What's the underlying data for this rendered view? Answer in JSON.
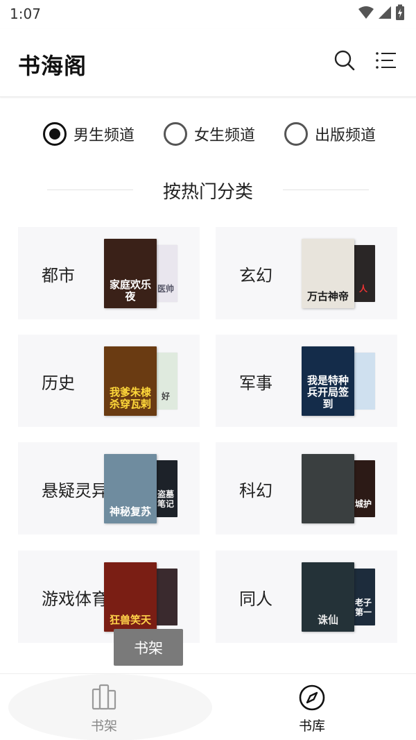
{
  "status_bar": {
    "time": "1:07",
    "icons": [
      "wifi-icon",
      "signal-icon",
      "battery-charging-icon"
    ]
  },
  "header": {
    "title": "书海阁",
    "icons": [
      "search-icon",
      "menu-list-icon"
    ]
  },
  "channels": [
    {
      "label": "男生频道",
      "selected": true
    },
    {
      "label": "女生频道",
      "selected": false
    },
    {
      "label": "出版频道",
      "selected": false
    }
  ],
  "section": {
    "title": "按热门分类"
  },
  "categories": [
    {
      "label": "都市",
      "front_cover_text": "家庭欢乐夜",
      "back_cover_text": "医帅",
      "front_color": "#3a2118",
      "front_text_color": "#ffffff",
      "back_color": "#e9e6ee",
      "back_text_color": "#556"
    },
    {
      "label": "玄幻",
      "front_cover_text": "万古神帝",
      "back_cover_text": "人",
      "front_color": "#e8e4dc",
      "front_text_color": "#1b1b1b",
      "back_color": "#2a2626",
      "back_text_color": "#e33"
    },
    {
      "label": "历史",
      "front_cover_text": "我爹朱棣杀穿瓦剌",
      "back_cover_text": "好",
      "front_color": "#6a3b12",
      "front_text_color": "#ffd83a",
      "back_color": "#dfeade",
      "back_text_color": "#444"
    },
    {
      "label": "军事",
      "front_cover_text": "我是特种兵开局签到",
      "back_cover_text": "",
      "front_color": "#142c4a",
      "front_text_color": "#ffffff",
      "back_color": "#cfe0ef",
      "back_text_color": "#333"
    },
    {
      "label": "悬疑灵异",
      "front_cover_text": "神秘复苏",
      "back_cover_text": "盗墓笔记",
      "front_color": "#6f8c9f",
      "front_text_color": "#ffffff",
      "back_color": "#1d2229",
      "back_text_color": "#f0f0f0"
    },
    {
      "label": "科幻",
      "front_cover_text": "",
      "back_cover_text": "城护",
      "front_color": "#3a3f40",
      "front_text_color": "#ffffff",
      "back_color": "#2c1a16",
      "back_text_color": "#ffffff"
    },
    {
      "label": "游戏体育",
      "front_cover_text": "狂兽笑天",
      "back_cover_text": "",
      "front_color": "#7a1e14",
      "front_text_color": "#ffd24a",
      "back_color": "#3a2a2e",
      "back_text_color": "#fff"
    },
    {
      "label": "同人",
      "front_cover_text": "诛仙",
      "back_cover_text": "老子第一",
      "front_color": "#243238",
      "front_text_color": "#e8e8e8",
      "back_color": "#1d2c3c",
      "back_text_color": "#ffffff"
    }
  ],
  "tooltip": {
    "text": "书架"
  },
  "bottom_nav": {
    "items": [
      {
        "label": "书架",
        "icon": "bookshelf-icon",
        "active": false
      },
      {
        "label": "书库",
        "icon": "compass-icon",
        "active": true
      }
    ]
  },
  "colors": {
    "card_bg": "#f7f7f9",
    "accent": "#111111",
    "tooltip_bg": "#7a7a7a"
  }
}
